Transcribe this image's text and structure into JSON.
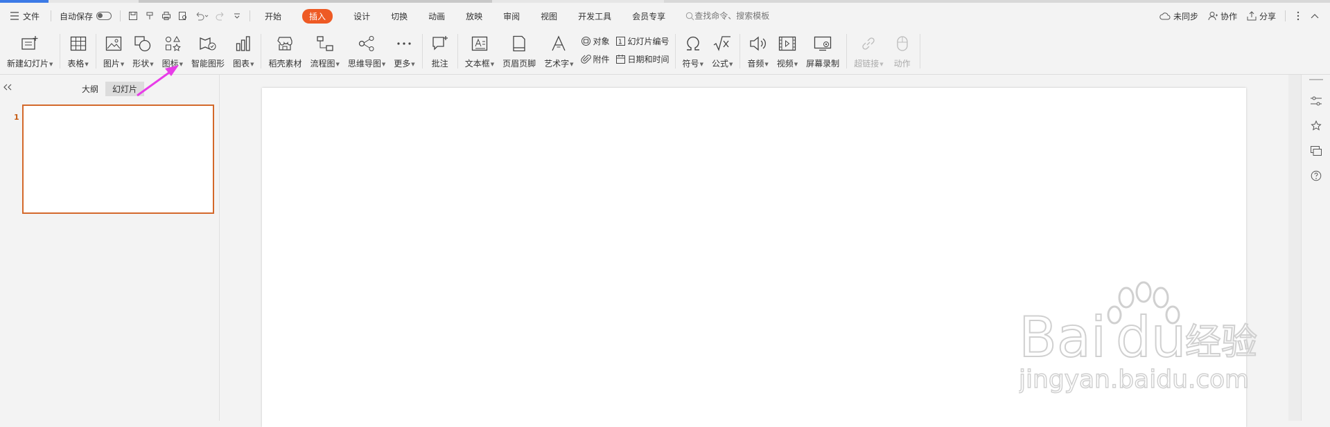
{
  "colors": {
    "accent": "#ee5a24",
    "thumb_border": "#d3682a",
    "progress_blue": "#3c7ae6",
    "annotation_arrow": "#e83ce8"
  },
  "menubar": {
    "file_label": "文件",
    "autosave_label": "自动保存",
    "tabs": [
      {
        "label": "开始"
      },
      {
        "label": "插入"
      },
      {
        "label": "设计"
      },
      {
        "label": "切换"
      },
      {
        "label": "动画"
      },
      {
        "label": "放映"
      },
      {
        "label": "审阅"
      },
      {
        "label": "视图"
      },
      {
        "label": "开发工具"
      },
      {
        "label": "会员专享"
      }
    ],
    "active_tab": "插入",
    "search_placeholder": "查找命令、搜索模板",
    "sync_label": "未同步",
    "collab_label": "协作",
    "share_label": "分享"
  },
  "ribbon": {
    "new_slide": "新建幻灯片",
    "table": "表格",
    "picture": "图片",
    "shape": "形状",
    "icon": "图标",
    "smart_graphic": "智能图形",
    "chart": "图表",
    "docer_material": "稻壳素材",
    "flowchart": "流程图",
    "mindmap": "思维导图",
    "more": "更多",
    "comment": "批注",
    "textbox": "文本框",
    "header_footer": "页眉页脚",
    "wordart": "艺术字",
    "object": "对象",
    "attachment": "附件",
    "slide_number": "幻灯片编号",
    "datetime": "日期和时间",
    "symbol": "符号",
    "formula": "公式",
    "audio": "音频",
    "video": "视频",
    "screen_record": "屏幕录制",
    "hyperlink": "超链接",
    "action": "动作"
  },
  "leftpanel": {
    "outline_tab": "大纲",
    "slides_tab": "幻灯片",
    "slide_number": "1"
  },
  "watermark": {
    "brand": "Bai",
    "brand_du": "du",
    "brand_cn": "经验",
    "url": "jingyan.baidu.com"
  }
}
